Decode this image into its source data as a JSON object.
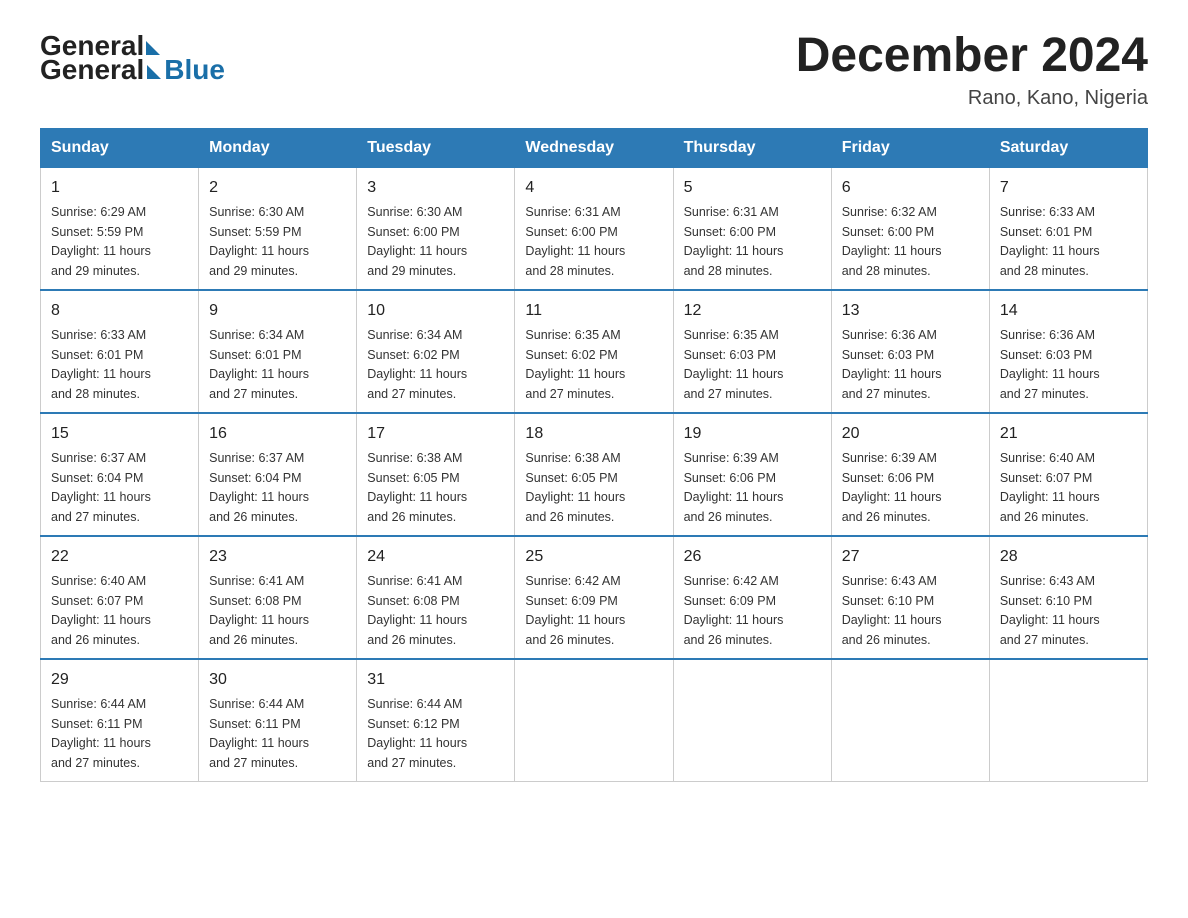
{
  "header": {
    "logo_general": "General",
    "logo_blue": "Blue",
    "title": "December 2024",
    "location": "Rano, Kano, Nigeria"
  },
  "days_of_week": [
    "Sunday",
    "Monday",
    "Tuesday",
    "Wednesday",
    "Thursday",
    "Friday",
    "Saturday"
  ],
  "weeks": [
    [
      {
        "day": "1",
        "sunrise": "6:29 AM",
        "sunset": "5:59 PM",
        "daylight": "11 hours and 29 minutes."
      },
      {
        "day": "2",
        "sunrise": "6:30 AM",
        "sunset": "5:59 PM",
        "daylight": "11 hours and 29 minutes."
      },
      {
        "day": "3",
        "sunrise": "6:30 AM",
        "sunset": "6:00 PM",
        "daylight": "11 hours and 29 minutes."
      },
      {
        "day": "4",
        "sunrise": "6:31 AM",
        "sunset": "6:00 PM",
        "daylight": "11 hours and 28 minutes."
      },
      {
        "day": "5",
        "sunrise": "6:31 AM",
        "sunset": "6:00 PM",
        "daylight": "11 hours and 28 minutes."
      },
      {
        "day": "6",
        "sunrise": "6:32 AM",
        "sunset": "6:00 PM",
        "daylight": "11 hours and 28 minutes."
      },
      {
        "day": "7",
        "sunrise": "6:33 AM",
        "sunset": "6:01 PM",
        "daylight": "11 hours and 28 minutes."
      }
    ],
    [
      {
        "day": "8",
        "sunrise": "6:33 AM",
        "sunset": "6:01 PM",
        "daylight": "11 hours and 28 minutes."
      },
      {
        "day": "9",
        "sunrise": "6:34 AM",
        "sunset": "6:01 PM",
        "daylight": "11 hours and 27 minutes."
      },
      {
        "day": "10",
        "sunrise": "6:34 AM",
        "sunset": "6:02 PM",
        "daylight": "11 hours and 27 minutes."
      },
      {
        "day": "11",
        "sunrise": "6:35 AM",
        "sunset": "6:02 PM",
        "daylight": "11 hours and 27 minutes."
      },
      {
        "day": "12",
        "sunrise": "6:35 AM",
        "sunset": "6:03 PM",
        "daylight": "11 hours and 27 minutes."
      },
      {
        "day": "13",
        "sunrise": "6:36 AM",
        "sunset": "6:03 PM",
        "daylight": "11 hours and 27 minutes."
      },
      {
        "day": "14",
        "sunrise": "6:36 AM",
        "sunset": "6:03 PM",
        "daylight": "11 hours and 27 minutes."
      }
    ],
    [
      {
        "day": "15",
        "sunrise": "6:37 AM",
        "sunset": "6:04 PM",
        "daylight": "11 hours and 27 minutes."
      },
      {
        "day": "16",
        "sunrise": "6:37 AM",
        "sunset": "6:04 PM",
        "daylight": "11 hours and 26 minutes."
      },
      {
        "day": "17",
        "sunrise": "6:38 AM",
        "sunset": "6:05 PM",
        "daylight": "11 hours and 26 minutes."
      },
      {
        "day": "18",
        "sunrise": "6:38 AM",
        "sunset": "6:05 PM",
        "daylight": "11 hours and 26 minutes."
      },
      {
        "day": "19",
        "sunrise": "6:39 AM",
        "sunset": "6:06 PM",
        "daylight": "11 hours and 26 minutes."
      },
      {
        "day": "20",
        "sunrise": "6:39 AM",
        "sunset": "6:06 PM",
        "daylight": "11 hours and 26 minutes."
      },
      {
        "day": "21",
        "sunrise": "6:40 AM",
        "sunset": "6:07 PM",
        "daylight": "11 hours and 26 minutes."
      }
    ],
    [
      {
        "day": "22",
        "sunrise": "6:40 AM",
        "sunset": "6:07 PM",
        "daylight": "11 hours and 26 minutes."
      },
      {
        "day": "23",
        "sunrise": "6:41 AM",
        "sunset": "6:08 PM",
        "daylight": "11 hours and 26 minutes."
      },
      {
        "day": "24",
        "sunrise": "6:41 AM",
        "sunset": "6:08 PM",
        "daylight": "11 hours and 26 minutes."
      },
      {
        "day": "25",
        "sunrise": "6:42 AM",
        "sunset": "6:09 PM",
        "daylight": "11 hours and 26 minutes."
      },
      {
        "day": "26",
        "sunrise": "6:42 AM",
        "sunset": "6:09 PM",
        "daylight": "11 hours and 26 minutes."
      },
      {
        "day": "27",
        "sunrise": "6:43 AM",
        "sunset": "6:10 PM",
        "daylight": "11 hours and 26 minutes."
      },
      {
        "day": "28",
        "sunrise": "6:43 AM",
        "sunset": "6:10 PM",
        "daylight": "11 hours and 27 minutes."
      }
    ],
    [
      {
        "day": "29",
        "sunrise": "6:44 AM",
        "sunset": "6:11 PM",
        "daylight": "11 hours and 27 minutes."
      },
      {
        "day": "30",
        "sunrise": "6:44 AM",
        "sunset": "6:11 PM",
        "daylight": "11 hours and 27 minutes."
      },
      {
        "day": "31",
        "sunrise": "6:44 AM",
        "sunset": "6:12 PM",
        "daylight": "11 hours and 27 minutes."
      },
      null,
      null,
      null,
      null
    ]
  ],
  "labels": {
    "sunrise": "Sunrise:",
    "sunset": "Sunset:",
    "daylight": "Daylight:"
  }
}
